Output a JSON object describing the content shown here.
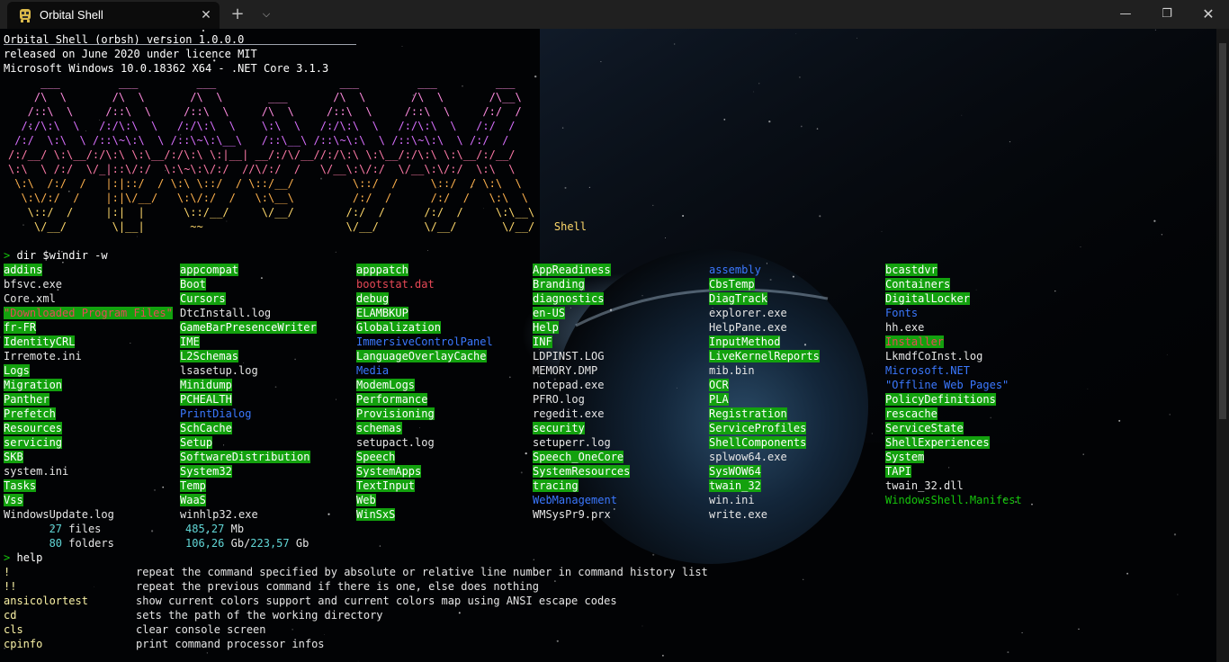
{
  "window": {
    "tab_title": "Orbital Shell",
    "tab_icon": "orbital-shell-app-icon",
    "close_tab_glyph": "✕",
    "new_tab_glyph": "+",
    "tab_menu_glyph": "⌵",
    "minimize_glyph": "—",
    "maximize_glyph": "❐",
    "close_glyph": "✕"
  },
  "colors": {
    "titlebar": "#202020",
    "terminal_bg": "#000000",
    "dir_highlight": "#13a10e",
    "system_blue": "#3b78ff",
    "hidden_red": "#e74856",
    "count_cyan": "#61d6d6",
    "help_yellow": "#f9f1a5",
    "logo_gradient": [
      "#ff8ce0",
      "#d870ff",
      "#ff7aa8",
      "#ffb24d",
      "#ffd96b"
    ]
  },
  "banner": {
    "lines": [
      "Orbital Shell (orbsh) version 1.0.0.0",
      "released on June 2020 under licence MIT",
      "Microsoft Windows 10.0.18362 X64 - .NET Core 3.1.3"
    ]
  },
  "logo": {
    "lines": [
      "     ___         ___         ___                   ___         ___         ___",
      "    /\\  \\       /\\  \\       /\\  \\       ___       /\\  \\       /\\  \\       /\\__\\",
      "   /::\\  \\     /::\\  \\     /::\\  \\     /\\  \\     /::\\  \\     /::\\  \\     /:/  /",
      "  /:/\\:\\  \\   /:/\\:\\  \\   /:/\\:\\  \\    \\:\\  \\   /:/\\:\\  \\   /:/\\:\\  \\   /:/  /",
      " /:/  \\:\\  \\ /::\\~\\:\\  \\ /::\\~\\:\\__\\   /::\\__\\ /::\\~\\:\\  \\ /::\\~\\:\\  \\ /:/  /",
      "/:/__/ \\:\\__/:/\\:\\ \\:\\__/:/\\:\\ \\:|__| __/:/\\/__//:/\\:\\ \\:\\__/:/\\:\\ \\:\\__/:/__/",
      "\\:\\  \\ /:/  \\/_|::\\/:/  \\:\\~\\:\\/:/  //\\/:/  /   \\/__\\:\\/:/  \\/__\\:\\/:/  \\:\\  \\",
      " \\:\\  /:/  /   |:|::/  / \\:\\ \\::/  / \\::/__/         \\::/  /     \\::/  / \\:\\  \\",
      "  \\:\\/:/  /    |:|\\/__/   \\:\\/:/  /   \\:\\__\\         /:/  /      /:/  /   \\:\\  \\",
      "   \\::/  /     |:|  |      \\::/__/     \\/__/        /:/  /      /:/  /     \\:\\__\\",
      "    \\/__/       \\|__|       ~~                      \\/__/       \\/__/       \\/__/   Shell"
    ]
  },
  "commands": {
    "prompt": ">",
    "dir_cmd": "dir $windir -w",
    "help_cmd": "help"
  },
  "listing": {
    "col_x": [
      4,
      200,
      396,
      592,
      788,
      984
    ],
    "rows": [
      [
        [
          "addins",
          "dir"
        ],
        [
          "appcompat",
          "dir"
        ],
        [
          "apppatch",
          "dir"
        ],
        [
          "AppReadiness",
          "dir"
        ],
        [
          "assembly",
          "sys"
        ],
        [
          "bcastdvr",
          "dir"
        ]
      ],
      [
        [
          "bfsvc.exe",
          "file"
        ],
        [
          "Boot",
          "dir"
        ],
        [
          "bootstat.dat",
          "hid"
        ],
        [
          "Branding",
          "dir"
        ],
        [
          "CbsTemp",
          "dir"
        ],
        [
          "Containers",
          "dir"
        ]
      ],
      [
        [
          "Core.xml",
          "file"
        ],
        [
          "Cursors",
          "dir"
        ],
        [
          "debug",
          "dir"
        ],
        [
          "diagnostics",
          "dir"
        ],
        [
          "DiagTrack",
          "dir"
        ],
        [
          "DigitalLocker",
          "dir"
        ]
      ],
      [
        [
          "\"Downloaded Program Files\"",
          "hidsys"
        ],
        [
          "DtcInstall.log",
          "file"
        ],
        [
          "ELAMBKUP",
          "dir"
        ],
        [
          "en-US",
          "dir"
        ],
        [
          "explorer.exe",
          "file"
        ],
        [
          "Fonts",
          "sys"
        ]
      ],
      [
        [
          "fr-FR",
          "dir"
        ],
        [
          "GameBarPresenceWriter",
          "dir"
        ],
        [
          "Globalization",
          "dir"
        ],
        [
          "Help",
          "dir"
        ],
        [
          "HelpPane.exe",
          "file"
        ],
        [
          "hh.exe",
          "file"
        ]
      ],
      [
        [
          "IdentityCRL",
          "dir"
        ],
        [
          "IME",
          "dir"
        ],
        [
          "ImmersiveControlPanel",
          "sys"
        ],
        [
          "INF",
          "dir"
        ],
        [
          "InputMethod",
          "dir"
        ],
        [
          "Installer",
          "hidsys"
        ]
      ],
      [
        [
          "Irremote.ini",
          "file"
        ],
        [
          "L2Schemas",
          "dir"
        ],
        [
          "LanguageOverlayCache",
          "dir"
        ],
        [
          "LDPINST.LOG",
          "file"
        ],
        [
          "LiveKernelReports",
          "dir"
        ],
        [
          "LkmdfCoInst.log",
          "file"
        ]
      ],
      [
        [
          "Logs",
          "dir"
        ],
        [
          "lsasetup.log",
          "file"
        ],
        [
          "Media",
          "sys"
        ],
        [
          "MEMORY.DMP",
          "file"
        ],
        [
          "mib.bin",
          "file"
        ],
        [
          "Microsoft.NET",
          "sys"
        ]
      ],
      [
        [
          "Migration",
          "dir"
        ],
        [
          "Minidump",
          "dir"
        ],
        [
          "ModemLogs",
          "dir"
        ],
        [
          "notepad.exe",
          "file"
        ],
        [
          "OCR",
          "dir"
        ],
        [
          "\"Offline Web Pages\"",
          "sys"
        ]
      ],
      [
        [
          "Panther",
          "dir"
        ],
        [
          "PCHEALTH",
          "dir"
        ],
        [
          "Performance",
          "dir"
        ],
        [
          "PFRO.log",
          "file"
        ],
        [
          "PLA",
          "dir"
        ],
        [
          "PolicyDefinitions",
          "dir"
        ]
      ],
      [
        [
          "Prefetch",
          "dir"
        ],
        [
          "PrintDialog",
          "sys"
        ],
        [
          "Provisioning",
          "dir"
        ],
        [
          "regedit.exe",
          "file"
        ],
        [
          "Registration",
          "dir"
        ],
        [
          "rescache",
          "dir"
        ]
      ],
      [
        [
          "Resources",
          "dir"
        ],
        [
          "SchCache",
          "dir"
        ],
        [
          "schemas",
          "dir"
        ],
        [
          "security",
          "dir"
        ],
        [
          "ServiceProfiles",
          "dir"
        ],
        [
          "ServiceState",
          "dir"
        ]
      ],
      [
        [
          "servicing",
          "dir"
        ],
        [
          "Setup",
          "dir"
        ],
        [
          "setupact.log",
          "file"
        ],
        [
          "setuperr.log",
          "file"
        ],
        [
          "ShellComponents",
          "dir"
        ],
        [
          "ShellExperiences",
          "dir"
        ]
      ],
      [
        [
          "SKB",
          "dir"
        ],
        [
          "SoftwareDistribution",
          "dir"
        ],
        [
          "Speech",
          "dir"
        ],
        [
          "Speech_OneCore",
          "dir"
        ],
        [
          "splwow64.exe",
          "file"
        ],
        [
          "System",
          "dir"
        ]
      ],
      [
        [
          "system.ini",
          "file"
        ],
        [
          "System32",
          "dir"
        ],
        [
          "SystemApps",
          "dir"
        ],
        [
          "SystemResources",
          "dir"
        ],
        [
          "SysWOW64",
          "dir"
        ],
        [
          "TAPI",
          "dir"
        ]
      ],
      [
        [
          "Tasks",
          "dir"
        ],
        [
          "Temp",
          "dir"
        ],
        [
          "TextInput",
          "dir"
        ],
        [
          "tracing",
          "dir"
        ],
        [
          "twain_32",
          "dir"
        ],
        [
          "twain_32.dll",
          "file"
        ]
      ],
      [
        [
          "Vss",
          "dir"
        ],
        [
          "WaaS",
          "dir"
        ],
        [
          "Web",
          "dir"
        ],
        [
          "WebManagement",
          "sys"
        ],
        [
          "win.ini",
          "file"
        ],
        [
          "WindowsShell.Manifest",
          "man"
        ]
      ],
      [
        [
          "WindowsUpdate.log",
          "file"
        ],
        [
          "winhlp32.exe",
          "file"
        ],
        [
          "WinSxS",
          "dir"
        ],
        [
          "WMSysPr9.prx",
          "file"
        ],
        [
          "write.exe",
          "file"
        ]
      ]
    ]
  },
  "summary": {
    "files_count": "27",
    "files_label": "files",
    "folders_count": "80",
    "folders_label": "folders",
    "files_size": "485,27",
    "files_size_unit": "Mb",
    "free_space": "106,26",
    "free_unit": "Gb",
    "separator": "/",
    "total_space": "223,57",
    "total_unit": "Gb"
  },
  "help": {
    "items": [
      {
        "cmd": "!",
        "desc": "repeat the command specified by absolute or relative line number in command history list"
      },
      {
        "cmd": "!!",
        "desc": "repeat the previous command if there is one, else does nothing"
      },
      {
        "cmd": "ansicolortest",
        "desc": "show current colors support and current colors map using ANSI escape codes"
      },
      {
        "cmd": "cd",
        "desc": "sets the path of the working directory"
      },
      {
        "cmd": "cls",
        "desc": "clear console screen"
      },
      {
        "cmd": "cpinfo",
        "desc": "print command processor infos"
      }
    ]
  }
}
